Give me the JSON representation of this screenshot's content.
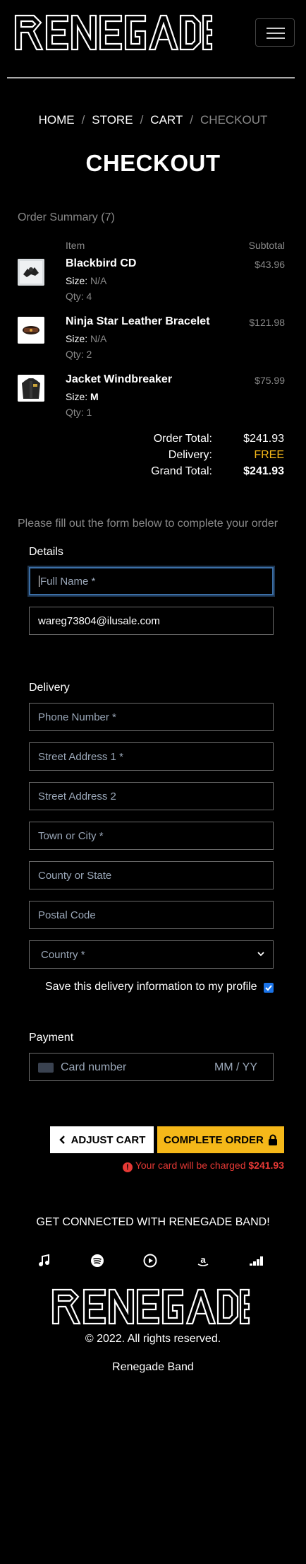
{
  "header": {
    "logo_text": "RENEGADE",
    "menu_icon": "hamburger-icon"
  },
  "breadcrumb": {
    "home": "HOME",
    "store": "STORE",
    "cart": "CART",
    "checkout": "CHECKOUT",
    "separator": "/"
  },
  "page_title": "CHECKOUT",
  "summary": {
    "title": "Order Summary (7)",
    "col_item": "Item",
    "col_subtotal": "Subtotal",
    "items": [
      {
        "name": "Blackbird CD",
        "size_label": "Size:",
        "size": "N/A",
        "qty": "Qty: 4",
        "price": "$43.96"
      },
      {
        "name": "Ninja Star Leather Bracelet",
        "size_label": "Size:",
        "size": "N/A",
        "qty": "Qty: 2",
        "price": "$121.98"
      },
      {
        "name": "Jacket Windbreaker",
        "size_label": "Size:",
        "size": "M",
        "qty": "Qty: 1",
        "price": "$75.99"
      }
    ],
    "order_total_label": "Order Total:",
    "order_total": "$241.93",
    "delivery_label": "Delivery:",
    "delivery": "FREE",
    "grand_total_label": "Grand Total:",
    "grand_total": "$241.93"
  },
  "form": {
    "intro": "Please fill out the form below to complete your order",
    "details_label": "Details",
    "full_name_placeholder": "Full Name *",
    "email_value": "wareg73804@ilusale.com",
    "delivery_label": "Delivery",
    "phone_placeholder": "Phone Number *",
    "street1_placeholder": "Street Address 1 *",
    "street2_placeholder": "Street Address 2",
    "town_placeholder": "Town or City *",
    "county_placeholder": "County or State",
    "postal_placeholder": "Postal Code",
    "country_selected": "Country *",
    "save_label": "Save this delivery information to my profile",
    "save_checked": true,
    "payment_label": "Payment",
    "card_placeholder": "Card number",
    "expiry_placeholder": "MM / YY"
  },
  "actions": {
    "adjust_label": "ADJUST CART",
    "complete_label": "COMPLETE ORDER",
    "charge_text": "Your card will be charged",
    "charge_amount": "$241.93"
  },
  "footer": {
    "connected": "GET CONNECTED WITH RENEGADE BAND!",
    "social_icons": [
      "music-note-icon",
      "spotify-icon",
      "youtube-music-icon",
      "amazon-icon",
      "deezer-icon"
    ],
    "logo_text": "RENEGADE",
    "copyright": "© 2022. All rights reserved.",
    "band": "Renegade Band"
  },
  "colors": {
    "accent": "#f5b819",
    "error": "#e53935",
    "muted": "#8a8a8a"
  }
}
